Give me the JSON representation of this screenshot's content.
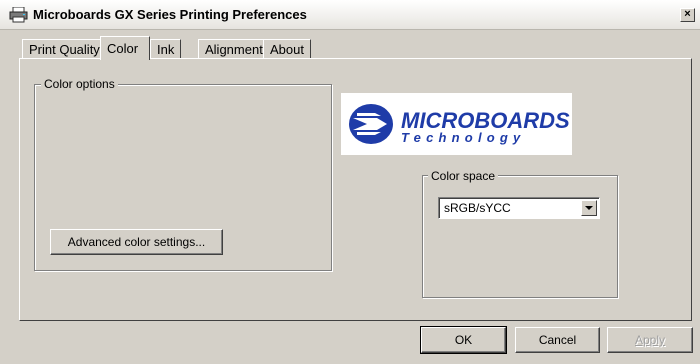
{
  "window": {
    "title": "Microboards GX Series Printing Preferences",
    "close_label": "×"
  },
  "tabs": [
    {
      "label": "Print Quality",
      "active": false
    },
    {
      "label": "Color",
      "active": true
    },
    {
      "label": "Ink",
      "active": false
    },
    {
      "label": "Alignment",
      "active": false
    },
    {
      "label": "About",
      "active": false
    }
  ],
  "color_options": {
    "group_label": "Color options",
    "advanced_button_label": "Advanced color settings..."
  },
  "logo": {
    "brand": "MICROBOARDS",
    "sub": "Technology",
    "brand_color": "#1f3ca8"
  },
  "color_space": {
    "group_label": "Color space",
    "selected": "sRGB/sYCC"
  },
  "buttons": {
    "ok": "OK",
    "cancel": "Cancel",
    "apply": "Apply"
  },
  "icons": {
    "app": "printer-icon",
    "dropdown": "chevron-down-icon",
    "logo_mark": "microboards-logo-icon"
  }
}
